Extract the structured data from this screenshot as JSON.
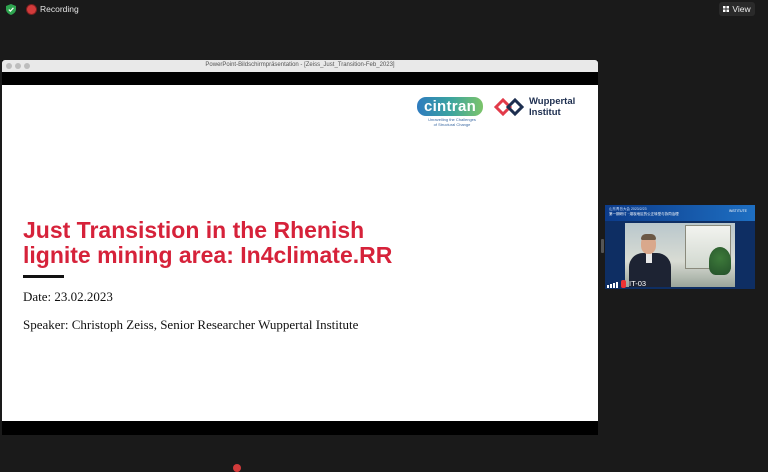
{
  "app": {
    "recording_label": "Recording",
    "view_label": "View"
  },
  "shared_window": {
    "title": "PowerPoint-Bildschirmpräsentation - [Zeiss_Just_Transition-Feb_2023]"
  },
  "slide": {
    "logos": {
      "cintran_word": "cintran",
      "cintran_tagline_1": "Unravelling the Challenges",
      "cintran_tagline_2": "of Structural Change",
      "wuppertal_line1": "Wuppertal",
      "wuppertal_line2": "Institut"
    },
    "title_line1": "Just Transistion in the Rhenish",
    "title_line2": "lignite mining area: In4climate.RR",
    "date": "Date: 23.02.2023",
    "speaker": "Speaker: Christoph Zeiss, Senior Researcher Wuppertal Institute"
  },
  "participant_tile": {
    "name": "IT-03",
    "banner_line1": "山东青岛大会 2023/2/23",
    "banner_line2": "第一期研讨 · 煤炭地区的公正转型与协同治理",
    "banner_logo": "INSTITUTE"
  },
  "colors": {
    "accent_red": "#d6223a",
    "recording_red": "#d23b3b",
    "shield_green": "#2ea44f"
  }
}
